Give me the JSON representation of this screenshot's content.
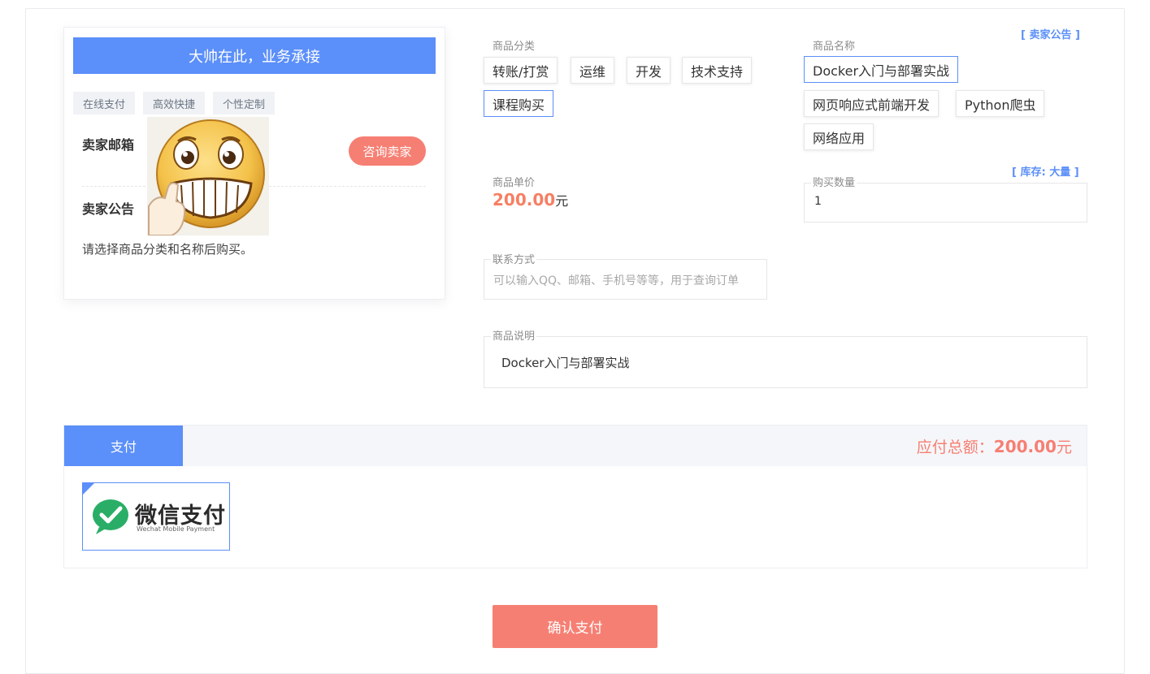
{
  "seller": {
    "header": "大帅在此，业务承接",
    "tags": [
      "在线支付",
      "高效快捷",
      "个性定制"
    ],
    "email_label": "卖家邮箱",
    "consult_button": "咨询卖家",
    "notice_label": "卖家公告",
    "notice_text": "请选择商品分类和名称后购买。"
  },
  "form": {
    "seller_notice_link": "[ 卖家公告 ]",
    "category_label": "商品分类",
    "categories": [
      "转账/打赏",
      "运维",
      "开发",
      "技术支持",
      "课程购买"
    ],
    "selected_category": "课程购买",
    "product_label": "商品名称",
    "products": [
      "Docker入门与部署实战",
      "网页响应式前端开发",
      "Python爬虫",
      "网络应用"
    ],
    "selected_product": "Docker入门与部署实战",
    "price_label": "商品单价",
    "price_value": "200.00",
    "price_unit": "元",
    "stock_link": "[ 库存: 大量 ]",
    "quantity_label": "购买数量",
    "quantity_value": "1",
    "contact_label": "联系方式",
    "contact_placeholder": "可以输入QQ、邮箱、手机号等等，用于查询订单",
    "description_label": "商品说明",
    "description_value": "Docker入门与部署实战"
  },
  "payment": {
    "tab_label": "支付",
    "total_label": "应付总额：",
    "total_value": "200.00",
    "total_unit": "元",
    "method_title": "微信支付",
    "method_subtitle": "Wechat Mobile Payment",
    "confirm_button": "确认支付"
  },
  "colors": {
    "accent": "#5b8ff9",
    "danger": "#f67f73",
    "wechat_green": "#2aae67"
  }
}
